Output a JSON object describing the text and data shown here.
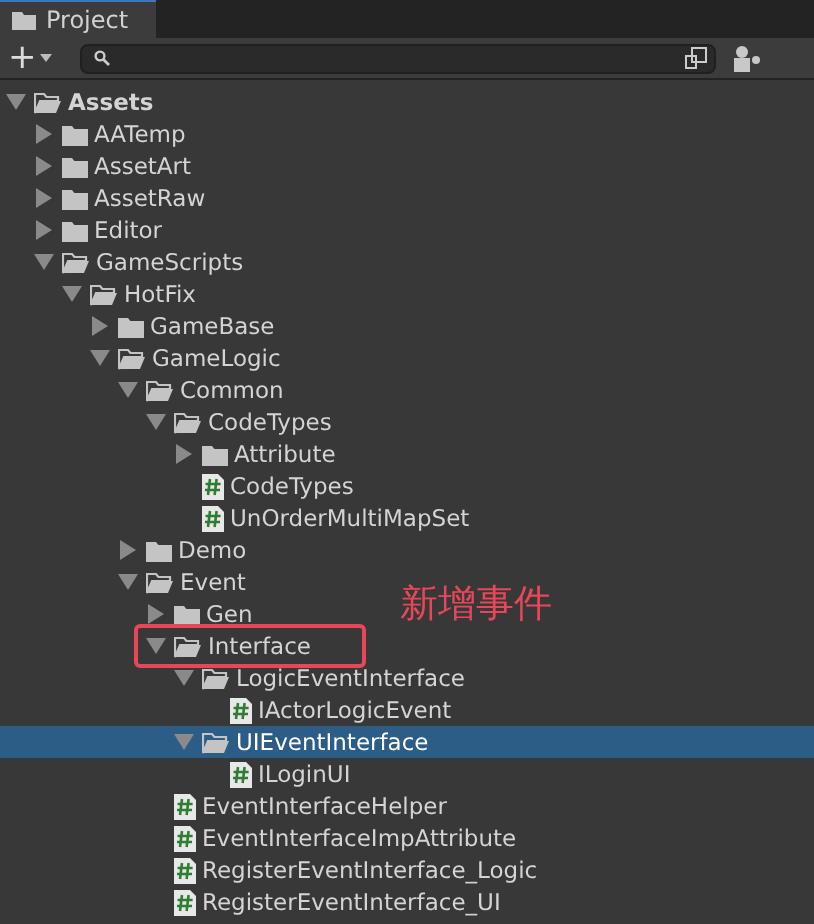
{
  "tab": {
    "label": "Project"
  },
  "toolbar": {
    "add_button": "+"
  },
  "tree": [
    {
      "label": "Assets",
      "kind": "folder",
      "bold": true,
      "expanded": true,
      "selected": false,
      "children": [
        {
          "label": "AATemp",
          "kind": "folder",
          "expanded": false,
          "selected": false
        },
        {
          "label": "AssetArt",
          "kind": "folder",
          "expanded": false,
          "selected": false
        },
        {
          "label": "AssetRaw",
          "kind": "folder",
          "expanded": false,
          "selected": false
        },
        {
          "label": "Editor",
          "kind": "folder",
          "expanded": false,
          "selected": false
        },
        {
          "label": "GameScripts",
          "kind": "folder",
          "expanded": true,
          "selected": false,
          "children": [
            {
              "label": "HotFix",
              "kind": "folder",
              "expanded": true,
              "selected": false,
              "children": [
                {
                  "label": "GameBase",
                  "kind": "folder",
                  "expanded": false,
                  "selected": false
                },
                {
                  "label": "GameLogic",
                  "kind": "folder",
                  "expanded": true,
                  "selected": false,
                  "children": [
                    {
                      "label": "Common",
                      "kind": "folder",
                      "expanded": true,
                      "selected": false,
                      "children": [
                        {
                          "label": "CodeTypes",
                          "kind": "folder",
                          "expanded": true,
                          "selected": false,
                          "children": [
                            {
                              "label": "Attribute",
                              "kind": "folder",
                              "expanded": false,
                              "selected": false
                            },
                            {
                              "label": "CodeTypes",
                              "kind": "script",
                              "selected": false
                            },
                            {
                              "label": "UnOrderMultiMapSet",
                              "kind": "script",
                              "selected": false
                            }
                          ]
                        }
                      ]
                    },
                    {
                      "label": "Demo",
                      "kind": "folder",
                      "expanded": false,
                      "selected": false
                    },
                    {
                      "label": "Event",
                      "kind": "folder",
                      "expanded": true,
                      "selected": false,
                      "children": [
                        {
                          "label": "Gen",
                          "kind": "folder",
                          "expanded": false,
                          "selected": false
                        },
                        {
                          "label": "Interface",
                          "kind": "folder",
                          "expanded": true,
                          "selected": false,
                          "circled": true,
                          "children": [
                            {
                              "label": "LogicEventInterface",
                              "kind": "folder",
                              "expanded": true,
                              "selected": false,
                              "children": [
                                {
                                  "label": "IActorLogicEvent",
                                  "kind": "script",
                                  "selected": false
                                }
                              ]
                            },
                            {
                              "label": "UIEventInterface",
                              "kind": "folder",
                              "expanded": true,
                              "selected": true,
                              "children": [
                                {
                                  "label": "ILoginUI",
                                  "kind": "script",
                                  "selected": false
                                }
                              ]
                            }
                          ]
                        },
                        {
                          "label": "EventInterfaceHelper",
                          "kind": "script",
                          "selected": false
                        },
                        {
                          "label": "EventInterfaceImpAttribute",
                          "kind": "script",
                          "selected": false
                        },
                        {
                          "label": "RegisterEventInterface_Logic",
                          "kind": "script",
                          "selected": false
                        },
                        {
                          "label": "RegisterEventInterface_UI",
                          "kind": "script",
                          "selected": false
                        }
                      ]
                    }
                  ]
                }
              ]
            }
          ]
        }
      ]
    }
  ],
  "annotation": {
    "text": "新增事件"
  }
}
